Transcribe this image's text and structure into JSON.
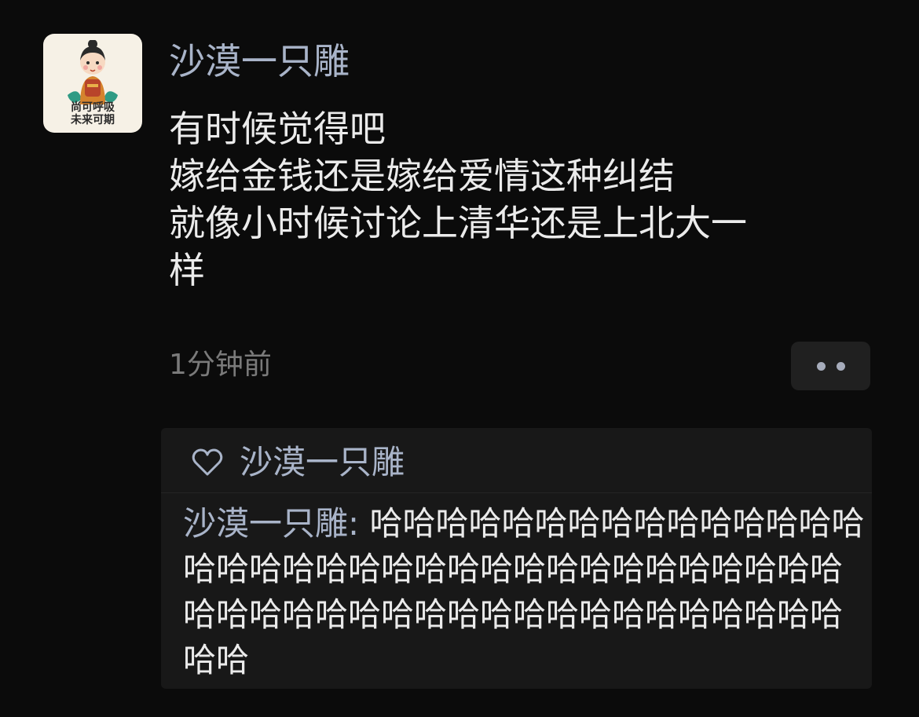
{
  "post": {
    "avatar": {
      "icon": "cartoon-girl-avatar",
      "caption_line1": "尚可呼吸",
      "caption_line2": "未来可期"
    },
    "username": "沙漠一只雕",
    "lines": [
      "有时候觉得吧",
      "嫁给金钱还是嫁给爱情这种纠结",
      "就像小时候讨论上清华还是上北大一",
      "样"
    ],
    "timestamp": "1分钟前",
    "more_icon": "two-dots-icon"
  },
  "interactions": {
    "like_icon": "heart-outline-icon",
    "liked_by": "沙漠一只雕",
    "comment": {
      "author": "沙漠一只雕",
      "separator": ": ",
      "text": "哈哈哈哈哈哈哈哈哈哈哈哈哈哈哈哈哈哈哈哈哈哈哈哈哈哈哈哈哈哈哈哈哈哈哈哈哈哈哈哈哈哈哈哈哈哈哈哈哈哈哈哈哈哈哈哈哈"
    }
  },
  "colors": {
    "background": "#0b0b0b",
    "name_blue": "#a9b4c9",
    "panel": "#181818",
    "timestamp_gray": "#7a7a7a"
  }
}
